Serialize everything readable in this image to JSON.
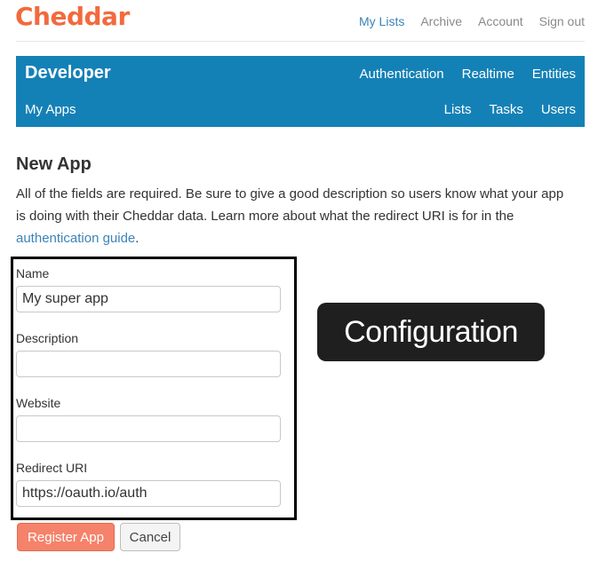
{
  "brand": {
    "logo_text": "Cheddar",
    "accent_color": "#f26a3d"
  },
  "topnav": {
    "items": [
      {
        "label": "My Lists",
        "active": true
      },
      {
        "label": "Archive",
        "active": false
      },
      {
        "label": "Account",
        "active": false
      },
      {
        "label": "Sign out",
        "active": false
      }
    ]
  },
  "devbar": {
    "title": "Developer",
    "primary_links": [
      "Authentication",
      "Realtime",
      "Entities"
    ],
    "section": "My Apps",
    "secondary_links": [
      "Lists",
      "Tasks",
      "Users"
    ],
    "color": "#1481b6"
  },
  "page": {
    "heading": "New App",
    "description_text": "All of the fields are required. Be sure to give a good description so users know what your app is doing with their Cheddar data. Learn more about what the redirect URI is for in the ",
    "description_link": "authentication guide",
    "description_end": "."
  },
  "form": {
    "name_label": "Name",
    "name_value": "My super app",
    "description_label": "Description",
    "description_value": "",
    "website_label": "Website",
    "website_value": "",
    "redirect_label": "Redirect URI",
    "redirect_value": "https://oauth.io/auth"
  },
  "callout": {
    "text": "Configuration"
  },
  "buttons": {
    "register": "Register App",
    "cancel": "Cancel"
  }
}
